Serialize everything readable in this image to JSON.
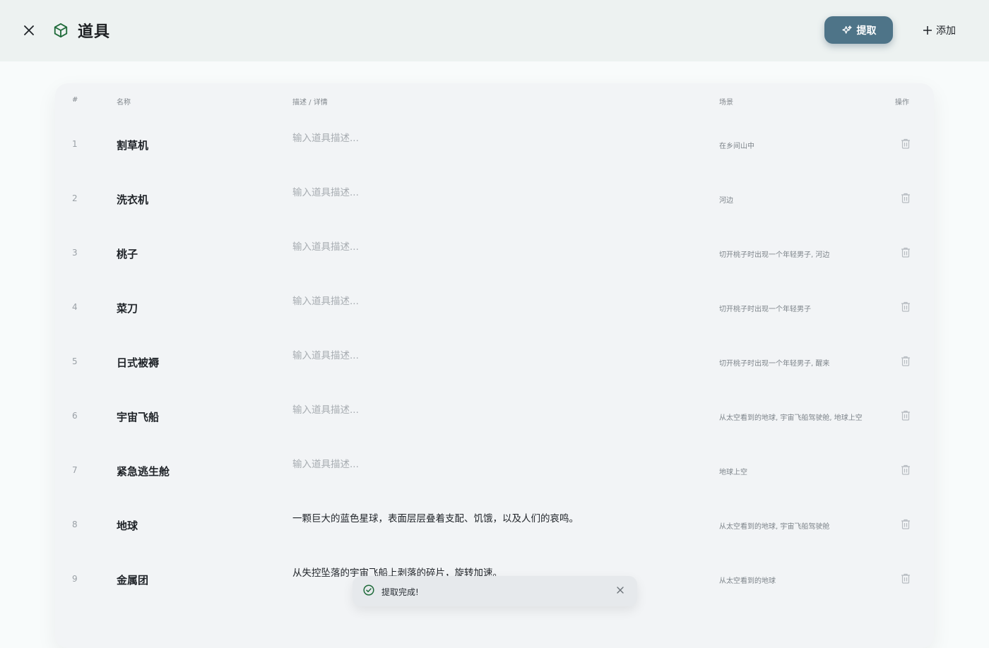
{
  "header": {
    "title": "道具",
    "extract_label": "提取",
    "add_label": "添加",
    "brand_color": "#4e7488",
    "icon_color": "#1f6b3a"
  },
  "table": {
    "columns": [
      "#",
      "名称",
      "描述 / 详情",
      "场景",
      "操作"
    ],
    "desc_placeholder": "输入道具描述...",
    "rows": [
      {
        "num": "1",
        "name": "割草机",
        "desc": "",
        "scene": "在乡间山中"
      },
      {
        "num": "2",
        "name": "洗衣机",
        "desc": "",
        "scene": "河边"
      },
      {
        "num": "3",
        "name": "桃子",
        "desc": "",
        "scene": "切开桃子时出现一个年轻男子, 河边"
      },
      {
        "num": "4",
        "name": "菜刀",
        "desc": "",
        "scene": "切开桃子时出现一个年轻男子"
      },
      {
        "num": "5",
        "name": "日式被褥",
        "desc": "",
        "scene": "切开桃子时出现一个年轻男子, 醒来"
      },
      {
        "num": "6",
        "name": "宇宙飞船",
        "desc": "",
        "scene": "从太空看到的地球, 宇宙飞船驾驶舱, 地球上空"
      },
      {
        "num": "7",
        "name": "紧急逃生舱",
        "desc": "",
        "scene": "地球上空"
      },
      {
        "num": "8",
        "name": "地球",
        "desc": "一颗巨大的蓝色星球，表面层层叠着支配、饥饿，以及人们的哀鸣。",
        "scene": "从太空看到的地球, 宇宙飞船驾驶舱"
      },
      {
        "num": "9",
        "name": "金属团",
        "desc": "从失控坠落的宇宙飞船上剥落的碎片，旋转加速。",
        "scene": "从太空看到的地球"
      }
    ]
  },
  "toast": {
    "message": "提取完成!",
    "icon": "check-circle-icon"
  }
}
